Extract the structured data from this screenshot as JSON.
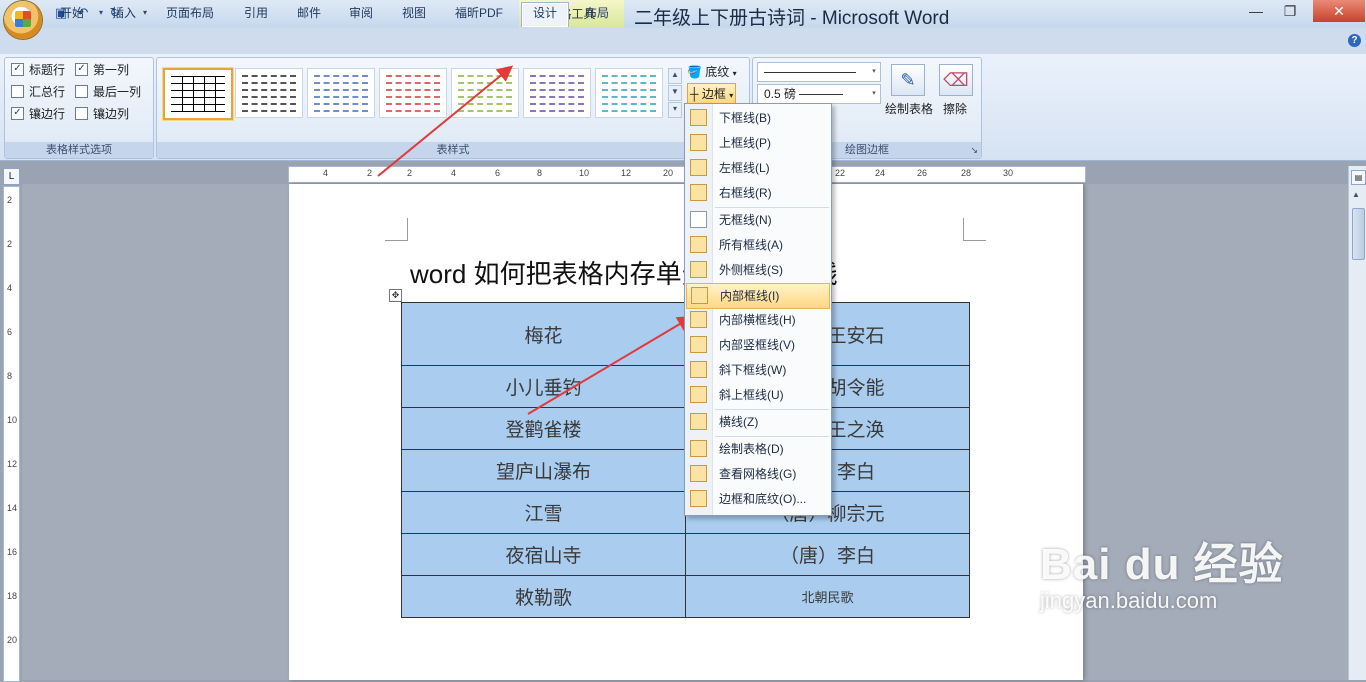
{
  "window": {
    "title": "二年级上下册古诗词 - Microsoft Word",
    "context_tab_header": "表格工具",
    "min": "—",
    "max": "❐",
    "close": "✕"
  },
  "tabs": [
    "开始",
    "插入",
    "页面布局",
    "引用",
    "邮件",
    "审阅",
    "视图",
    "福昕PDF",
    "设计",
    "布局"
  ],
  "active_tab": "设计",
  "ribbon": {
    "style_options": {
      "label": "表格样式选项",
      "items": [
        {
          "label": "标题行",
          "checked": true
        },
        {
          "label": "第一列",
          "checked": true
        },
        {
          "label": "汇总行",
          "checked": false
        },
        {
          "label": "最后一列",
          "checked": false
        },
        {
          "label": "镶边行",
          "checked": true
        },
        {
          "label": "镶边列",
          "checked": false
        }
      ]
    },
    "table_styles": {
      "label": "表样式",
      "shading_label": "底纹",
      "borders_label": "边框",
      "tile_colors": [
        "#000000",
        "#555555",
        "#6f8fc6",
        "#d96a6a",
        "#a5c56a",
        "#8a76b8",
        "#5fb5c9"
      ]
    },
    "draw_borders": {
      "label": "绘图边框",
      "pen_weight": "0.5 磅",
      "draw_table": "绘制表格",
      "eraser": "擦除"
    }
  },
  "document": {
    "title": "word 如何把表格内存单元格设为虚线",
    "table": [
      [
        "梅花",
        "（宋）王安石"
      ],
      [
        "小儿垂钓",
        "（唐）胡令能"
      ],
      [
        "登鹳雀楼",
        "（唐）王之涣"
      ],
      [
        "望庐山瀑布",
        "（唐）李白"
      ],
      [
        "江雪",
        "（唐）柳宗元"
      ],
      [
        "夜宿山寺",
        "（唐）李白"
      ],
      [
        "敕勒歌",
        "北朝民歌"
      ]
    ]
  },
  "borders_menu": {
    "items": [
      {
        "label": "下框线(B)",
        "icon": "bottom-border-icon"
      },
      {
        "label": "上框线(P)",
        "icon": "top-border-icon"
      },
      {
        "label": "左框线(L)",
        "icon": "left-border-icon"
      },
      {
        "label": "右框线(R)",
        "icon": "right-border-icon"
      },
      {
        "label": "无框线(N)",
        "icon": "no-border-icon"
      },
      {
        "label": "所有框线(A)",
        "icon": "all-borders-icon"
      },
      {
        "label": "外侧框线(S)",
        "icon": "outside-borders-icon"
      },
      {
        "label": "内部框线(I)",
        "icon": "inside-borders-icon",
        "highlighted": true
      },
      {
        "label": "内部横框线(H)",
        "icon": "inside-horizontal-border-icon"
      },
      {
        "label": "内部竖框线(V)",
        "icon": "inside-vertical-border-icon"
      },
      {
        "label": "斜下框线(W)",
        "icon": "diagonal-down-border-icon"
      },
      {
        "label": "斜上框线(U)",
        "icon": "diagonal-up-border-icon"
      },
      {
        "label": "横线(Z)",
        "icon": "horizontal-line-icon"
      },
      {
        "label": "绘制表格(D)",
        "icon": "draw-table-icon"
      },
      {
        "label": "查看网格线(G)",
        "icon": "view-gridlines-icon"
      },
      {
        "label": "边框和底纹(O)...",
        "icon": "borders-shading-icon"
      }
    ]
  },
  "ruler": {
    "h_ticks": [
      "4",
      "2",
      "2",
      "4",
      "6",
      "8",
      "10",
      "12",
      "20",
      "22",
      "24",
      "26",
      "28",
      "30"
    ],
    "v_ticks": [
      "2",
      "2",
      "4",
      "6",
      "8",
      "10",
      "12",
      "14",
      "16",
      "18",
      "20"
    ]
  },
  "watermark": {
    "brand": "Bai du 经验",
    "url": "jingyan.baidu.com"
  }
}
